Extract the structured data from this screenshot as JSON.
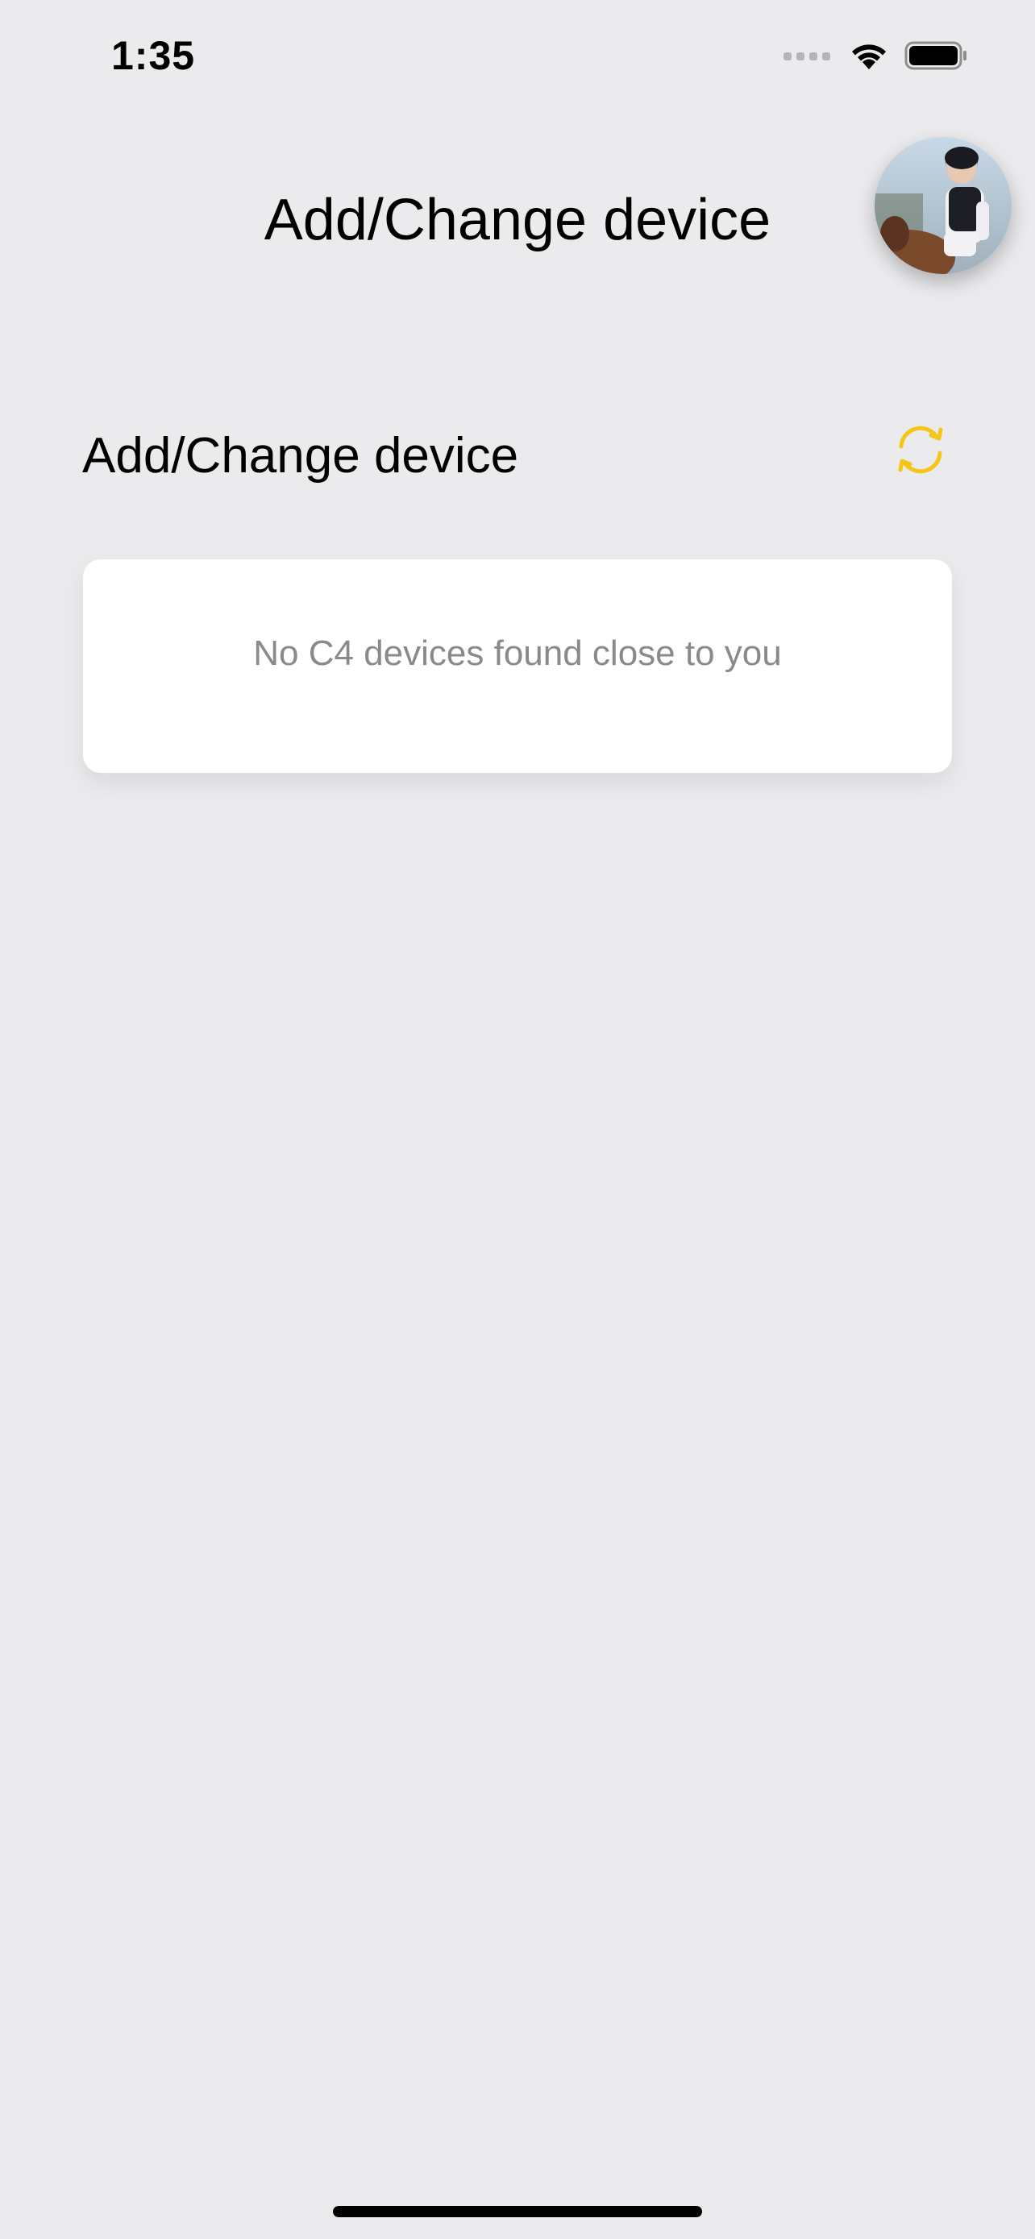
{
  "status_bar": {
    "time": "1:35"
  },
  "header": {
    "title": "Add/Change device",
    "avatar_icon": "user-avatar-photo"
  },
  "section": {
    "title": "Add/Change device",
    "refresh_icon": "refresh-icon"
  },
  "devices": {
    "empty_message": "No C4 devices found close to you",
    "items": []
  },
  "colors": {
    "accent": "#F5C518",
    "background": "#EBEBEE",
    "card": "#FFFFFF",
    "muted_text": "#8A8A8A"
  }
}
